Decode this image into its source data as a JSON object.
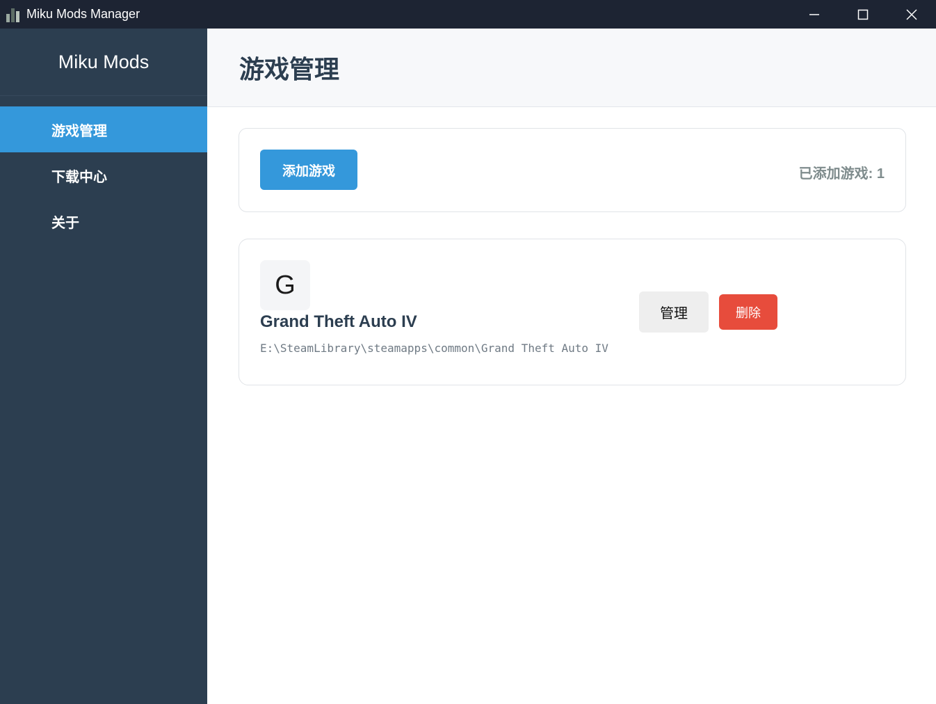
{
  "window": {
    "title": "Miku Mods Manager",
    "icon": "app-icon"
  },
  "sidebar": {
    "brand": "Miku Mods",
    "items": [
      {
        "label": "游戏管理",
        "active": true
      },
      {
        "label": "下载中心",
        "active": false
      },
      {
        "label": "关于",
        "active": false
      }
    ]
  },
  "main": {
    "title": "游戏管理",
    "toolbar": {
      "add_label": "添加游戏",
      "count_text": "已添加游戏: 1"
    },
    "games": [
      {
        "logo_letter": "G",
        "name": "Grand Theft Auto IV",
        "path": "E:\\SteamLibrary\\steamapps\\common\\Grand Theft Auto IV",
        "manage_label": "管理",
        "delete_label": "删除"
      }
    ]
  },
  "colors": {
    "sidebar_bg": "#2c3e50",
    "accent": "#3498db",
    "danger": "#e74c3c",
    "titlebar_bg": "#1d2433"
  }
}
